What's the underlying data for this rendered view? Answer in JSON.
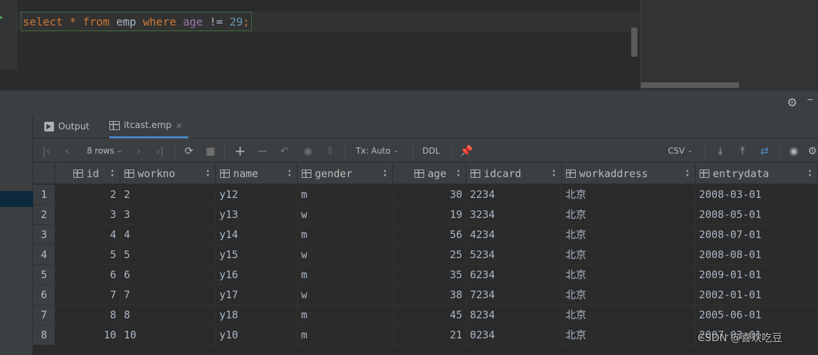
{
  "editor": {
    "sql": {
      "select": "select",
      "star": " * ",
      "from": "from",
      "table": " emp ",
      "where": "where",
      "column": " age",
      "op": " != ",
      "value": "29",
      "semi": ";"
    }
  },
  "tabs": [
    {
      "label": "Output",
      "icon": "output-icon"
    },
    {
      "label": "itcast.emp",
      "icon": "table-icon",
      "close": "✕"
    }
  ],
  "toolbar": {
    "rows_label": "8 rows",
    "tx_label": "Tx: Auto",
    "ddl_label": "DDL",
    "csv_label": "CSV"
  },
  "columns": [
    "id",
    "workno",
    "name",
    "gender",
    "age",
    "idcard",
    "workaddress",
    "entrydata"
  ],
  "rows": [
    {
      "n": "1",
      "id": "2",
      "workno": "2",
      "name": "y12",
      "gender": "m",
      "age": "30",
      "idcard": "2234",
      "workaddress": "北京",
      "entrydata": "2008-03-01"
    },
    {
      "n": "2",
      "id": "3",
      "workno": "3",
      "name": "y13",
      "gender": "w",
      "age": "19",
      "idcard": "3234",
      "workaddress": "北京",
      "entrydata": "2008-05-01"
    },
    {
      "n": "3",
      "id": "4",
      "workno": "4",
      "name": "y14",
      "gender": "m",
      "age": "56",
      "idcard": "4234",
      "workaddress": "北京",
      "entrydata": "2008-07-01"
    },
    {
      "n": "4",
      "id": "5",
      "workno": "5",
      "name": "y15",
      "gender": "w",
      "age": "25",
      "idcard": "5234",
      "workaddress": "北京",
      "entrydata": "2008-08-01"
    },
    {
      "n": "5",
      "id": "6",
      "workno": "6",
      "name": "y16",
      "gender": "m",
      "age": "35",
      "idcard": "6234",
      "workaddress": "北京",
      "entrydata": "2009-01-01"
    },
    {
      "n": "6",
      "id": "7",
      "workno": "7",
      "name": "y17",
      "gender": "w",
      "age": "38",
      "idcard": "7234",
      "workaddress": "北京",
      "entrydata": "2002-01-01"
    },
    {
      "n": "7",
      "id": "8",
      "workno": "8",
      "name": "y18",
      "gender": "m",
      "age": "45",
      "idcard": "8234",
      "workaddress": "北京",
      "entrydata": "2005-06-01"
    },
    {
      "n": "8",
      "id": "10",
      "workno": "10",
      "name": "y10",
      "gender": "m",
      "age": "21",
      "idcard": "0234",
      "workaddress": "北京",
      "entrydata": "2007-03-01"
    }
  ],
  "watermark": "CSDN @喜欢吃豆",
  "colors": {
    "keyword": "#cc7832",
    "identifier": "#a9b7c6",
    "column": "#9876aa",
    "number": "#6897bb",
    "selection": "#0d293e"
  }
}
